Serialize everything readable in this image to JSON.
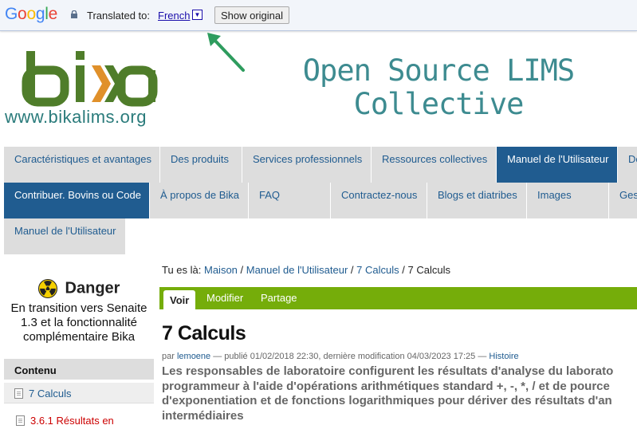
{
  "translate_bar": {
    "logo_text": "Google",
    "label": "Translated to:",
    "language": "French",
    "dropdown_glyph": "▼",
    "show_original": "Show original"
  },
  "header": {
    "logo_text": "bika",
    "url": "www.bikalims.org",
    "tagline_line1": "Open Source LIMS",
    "tagline_line2": "Collective"
  },
  "nav": {
    "row1": [
      "Caractéristiques et avantages",
      "Des produits",
      "Services professionnels",
      "Ressources collectives",
      "Manuel de l'Utilisateur",
      "De"
    ],
    "row2": [
      "Contribuer. Bovins ou Code",
      "À propos de Bika",
      "FAQ",
      "Contractez-nous",
      "Blogs et diatribes",
      "Images",
      "Ges"
    ],
    "row3": [
      "Manuel de l'Utilisateur"
    ]
  },
  "breadcrumb": {
    "prefix": "Tu es là:",
    "items": [
      "Maison",
      "Manuel de l'Utilisateur",
      "7 Calculs"
    ],
    "current": "7 Calculs",
    "sep": "/"
  },
  "tabs": [
    "Voir",
    "Modifier",
    "Partage"
  ],
  "content": {
    "title": "7 Calculs",
    "by": "par",
    "author": "lemoene",
    "meta": "— publié 01/02/2018 22:30, dernière modification 04/03/2023 17:25 —",
    "history": "Histoire",
    "description_lines": [
      "Les responsables de laboratoire configurent les résultats d'analyse du laborato",
      "programmeur à l'aide d'opérations arithmétiques standard +, -, *, / et de pource",
      "d'exponentiation et de fonctions logarithmiques pour dériver des résultats d'an",
      "intermédiaires"
    ]
  },
  "sidebar": {
    "danger_title": "Danger",
    "danger_lines": [
      "En transition vers Senaite",
      "1.3 et la fonctionnalité",
      "complémentaire Bika"
    ],
    "toc_title": "Contenu",
    "toc_item": "7 Calculs",
    "toc_sub": "3.6.1 Résultats en"
  },
  "colors": {
    "nav_active": "#205c90",
    "tab_bar": "#75ad0a",
    "bika_green": "#4f7d2a",
    "bika_orange": "#e0902a",
    "tagline": "#3d8b90",
    "arrow": "#2e9c5e"
  }
}
